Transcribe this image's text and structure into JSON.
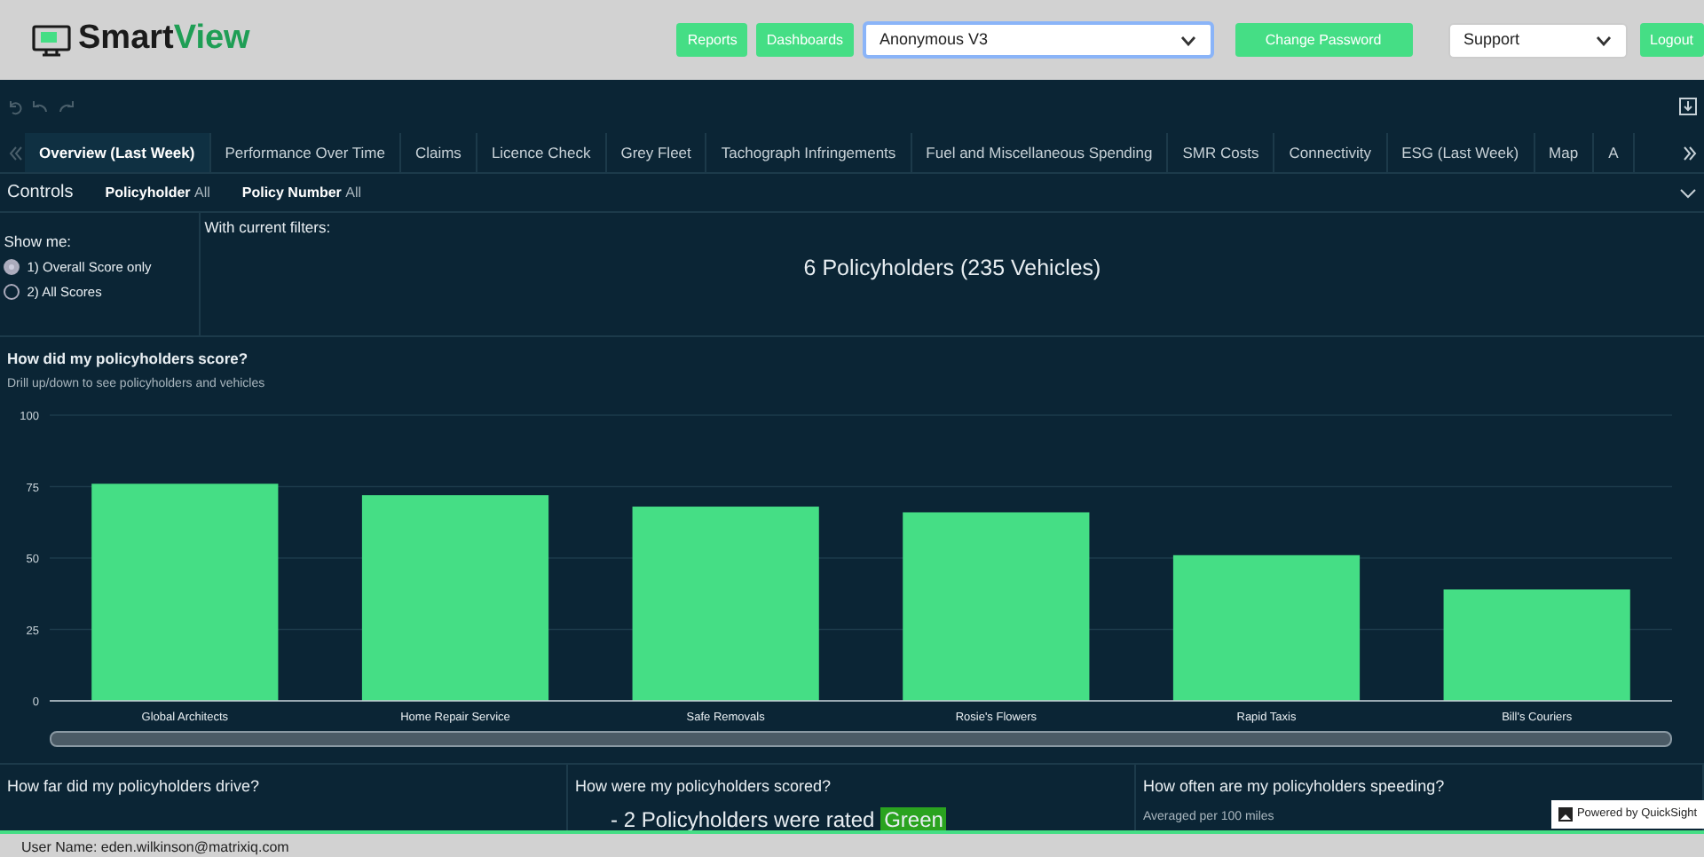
{
  "header": {
    "brand_prefix": "Smart",
    "brand_suffix": "View",
    "buttons": [
      "Reports",
      "Dashboards"
    ],
    "dataset_select": "Anonymous V3",
    "change_password": "Change Password",
    "support_select": "Support",
    "logout": "Logout"
  },
  "tabs": [
    {
      "label": "Overview (Last Week)",
      "selected": true
    },
    {
      "label": "Performance Over Time",
      "selected": false
    },
    {
      "label": "Claims",
      "selected": false
    },
    {
      "label": "Licence Check",
      "selected": false
    },
    {
      "label": "Grey Fleet",
      "selected": false
    },
    {
      "label": "Tachograph Infringements",
      "selected": false
    },
    {
      "label": "Fuel and Miscellaneous Spending",
      "selected": false
    },
    {
      "label": "SMR Costs",
      "selected": false
    },
    {
      "label": "Connectivity",
      "selected": false
    },
    {
      "label": "ESG (Last Week)",
      "selected": false
    },
    {
      "label": "Map",
      "selected": false
    },
    {
      "label": "A",
      "selected": false
    }
  ],
  "controls": {
    "title": "Controls",
    "filters": [
      {
        "label": "Policyholder",
        "value": "All"
      },
      {
        "label": "Policy Number",
        "value": "All"
      }
    ]
  },
  "show_me": {
    "title": "Show me:",
    "options": [
      {
        "label": "1) Overall Score only",
        "selected": true
      },
      {
        "label": "2) All Scores",
        "selected": false
      }
    ]
  },
  "summary": {
    "title": "With current filters:",
    "value": "6 Policyholders (235 Vehicles)"
  },
  "score_chart": {
    "title": "How did my policyholders score?",
    "subtitle": "Drill up/down to see policyholders and vehicles",
    "chart_data": {
      "type": "bar",
      "categories": [
        "Global Architects",
        "Home Repair Service",
        "Safe Removals",
        "Rosie's Flowers",
        "Rapid Taxis",
        "Bill's Couriers"
      ],
      "series": [
        {
          "color": "#45de85",
          "values": [
            76,
            72,
            68,
            66,
            51,
            39
          ]
        }
      ],
      "ylim": [
        0,
        100
      ],
      "yticks": [
        0,
        25,
        50,
        75,
        100
      ],
      "grid": true
    }
  },
  "panels": [
    {
      "title": "How far did my policyholders drive?"
    },
    {
      "title": "How were my policyholders scored?",
      "text": "- 2 Policyholders were rated",
      "rating": "Green"
    },
    {
      "title": "How often are my policyholders speeding?",
      "subtitle": "Averaged per 100 miles"
    }
  ],
  "powered_by": "Powered by QuickSight",
  "footer": "User Name: eden.wilkinson@matrixiq.com"
}
